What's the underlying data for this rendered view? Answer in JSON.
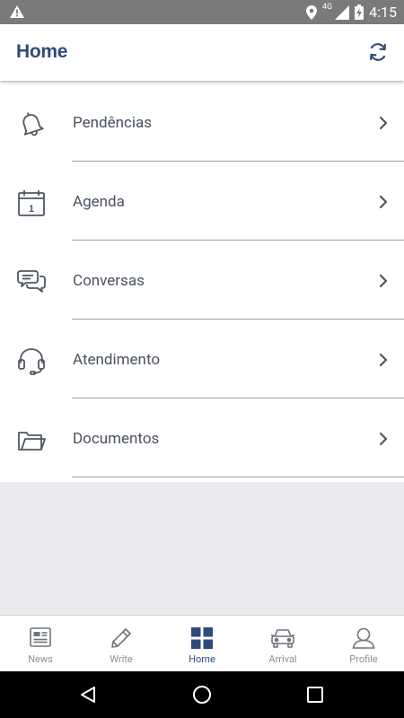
{
  "status_bar": {
    "time": "4:15",
    "network": "4G"
  },
  "app_bar": {
    "title": "Home"
  },
  "menu": {
    "items": [
      {
        "label": "Pendências",
        "icon": "bell-icon"
      },
      {
        "label": "Agenda",
        "icon": "calendar-icon",
        "calendar_day": "1"
      },
      {
        "label": "Conversas",
        "icon": "chat-bubbles-icon"
      },
      {
        "label": "Atendimento",
        "icon": "headset-icon"
      },
      {
        "label": "Documentos",
        "icon": "folder-icon"
      }
    ]
  },
  "bottom_nav": {
    "tabs": [
      {
        "label": "News",
        "icon": "newspaper-icon"
      },
      {
        "label": "Write",
        "icon": "pencil-icon"
      },
      {
        "label": "Home",
        "icon": "grid-icon",
        "active": true
      },
      {
        "label": "Arrival",
        "icon": "car-icon"
      },
      {
        "label": "Profile",
        "icon": "person-icon"
      }
    ]
  },
  "colors": {
    "accent": "#2f4a7a",
    "text": "#4a5260",
    "icon": "#4f5764",
    "background_gray": "#ebebef"
  }
}
